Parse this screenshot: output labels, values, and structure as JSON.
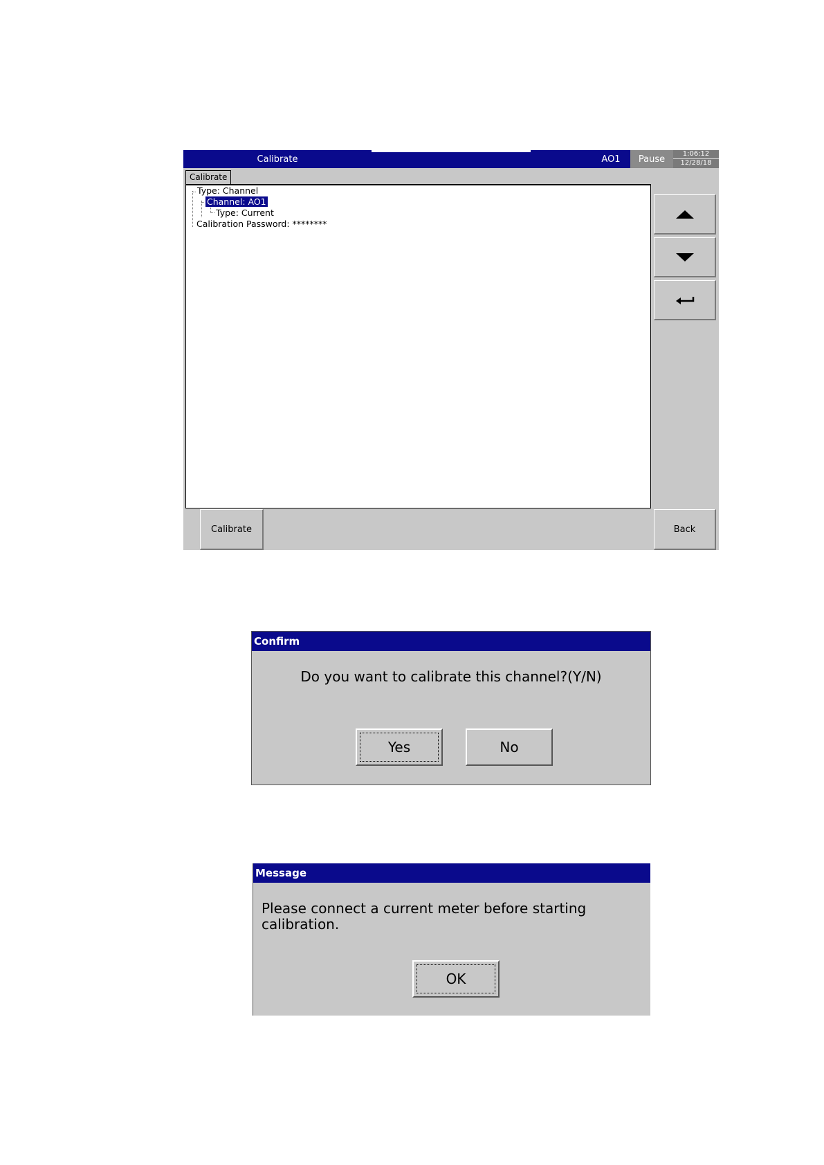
{
  "screen": {
    "title_left": "Calibrate",
    "title_center": "AO1",
    "pause_label": "Pause",
    "clock": {
      "time": "1:06:12",
      "date": "12/28/18"
    },
    "tab_label": "Calibrate",
    "tree": [
      {
        "text": "Type: Channel",
        "selected": false
      },
      {
        "text": "Channel: AO1",
        "selected": true
      },
      {
        "text": "Type: Current",
        "selected": false
      },
      {
        "text": "Calibration Password: ********",
        "selected": false
      }
    ],
    "side_buttons": {
      "up_icon": "arrow-up-icon",
      "down_icon": "arrow-down-icon",
      "enter_icon": "enter-icon"
    },
    "bottom": {
      "calibrate_label": "Calibrate",
      "back_label": "Back"
    }
  },
  "confirm_dialog": {
    "title": "Confirm",
    "message": "Do you want to calibrate this channel?(Y/N)",
    "yes_label": "Yes",
    "no_label": "No"
  },
  "message_dialog": {
    "title": "Message",
    "message": "Please connect a current meter before starting calibration.",
    "ok_label": "OK"
  },
  "colors": {
    "titlebar": "#0a0a8c",
    "panel": "#c8c8c8",
    "selection": "#0a0a8c"
  }
}
